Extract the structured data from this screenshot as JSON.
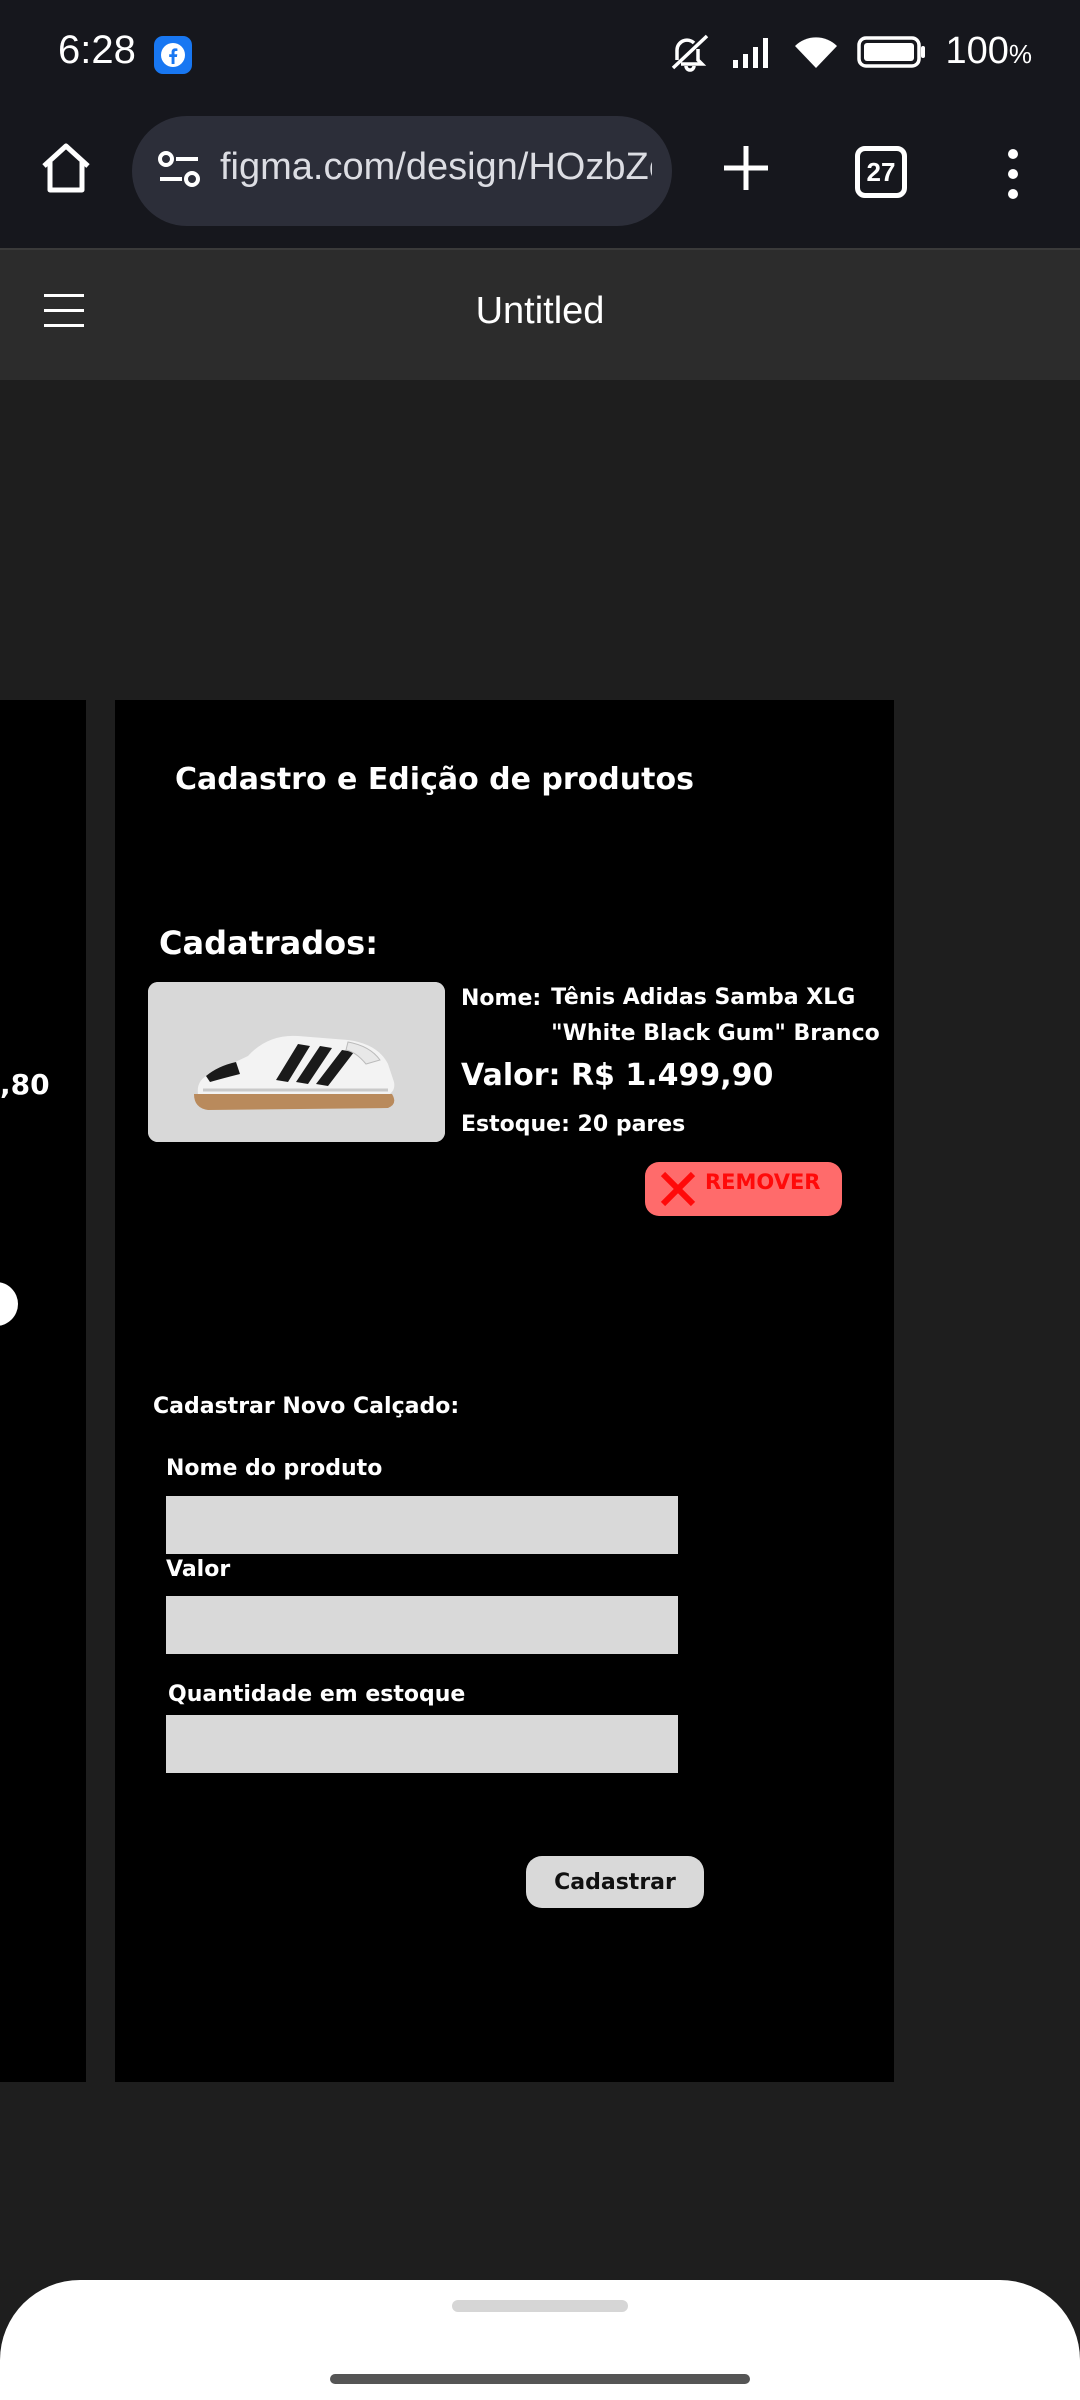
{
  "status_bar": {
    "time": "6:28",
    "battery_percent": "100",
    "battery_symbol": "%",
    "icons": [
      "facebook-icon",
      "mute-icon",
      "signal-icon",
      "wifi-icon",
      "battery-icon"
    ]
  },
  "browser": {
    "url": "figma.com/design/HOzbZe",
    "tab_count": "27",
    "icons": [
      "home-icon",
      "site-settings-icon",
      "plus-icon",
      "more-vertical-icon"
    ]
  },
  "figma": {
    "document_title": "Untitled"
  },
  "canvas": {
    "left_frame_text": ",80",
    "main_frame": {
      "title": "Cadastro e Edição de produtos",
      "registered_label": "Cadatrados:",
      "product": {
        "name_label": "Nome:",
        "name_value": "Tênis Adidas Samba XLG \"White Black Gum\" Branco",
        "price_text": "Valor:  R$ 1.499,90",
        "stock_text": "Estoque: 20 pares",
        "remove_label": "REMOVER"
      },
      "form": {
        "title": "Cadastrar Novo Calçado:",
        "name_label": "Nome do produto",
        "name_value": "",
        "price_label": "Valor",
        "price_value": "",
        "quantity_label": "Quantidade em estoque",
        "quantity_value": "",
        "submit_label": "Cadastrar"
      }
    }
  },
  "colors": {
    "background": "#1e1e1e",
    "frame": "#000000",
    "remove_button": "#ff6b6b",
    "remove_text": "#ff0a0a",
    "input": "#d9d9d9"
  }
}
